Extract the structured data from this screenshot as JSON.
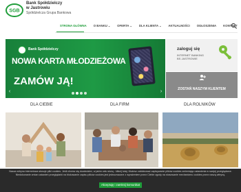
{
  "brand": {
    "logo_text": "SGB",
    "name_line1": "Bank Spółdzielczy",
    "name_line2": "w Jastrowiu",
    "group": "Spółdzielcza Grupa Bankowa",
    "colors": {
      "primary": "#1f9d3a",
      "dark": "#2a2a2a"
    }
  },
  "nav": {
    "items": [
      {
        "label": "STRONA GŁÓWNA",
        "active": true,
        "dropdown": false
      },
      {
        "label": "O BANKU",
        "active": false,
        "dropdown": true
      },
      {
        "label": "OFERTA",
        "active": false,
        "dropdown": true
      },
      {
        "label": "DLA KLIENTA",
        "active": false,
        "dropdown": true
      },
      {
        "label": "AKTUALNOŚCI",
        "active": false,
        "dropdown": false
      },
      {
        "label": "OGŁOSZENIA",
        "active": false,
        "dropdown": false
      },
      {
        "label": "KONTAKT",
        "active": false,
        "dropdown": false
      }
    ],
    "search_icon": "search-icon"
  },
  "slider": {
    "brand": "Bank Spółdzielczy",
    "title": "NOWA KARTA MŁODZIEŻOWA",
    "cta": "ZAMÓW JĄ!",
    "slides": 4,
    "active_slide": 2
  },
  "login": {
    "title": "zaloguj się",
    "line1": "INTERNET BANKING",
    "line2": "BS Jastrowie",
    "icon": "key-icon"
  },
  "open_account": {
    "label": "ZOSTAŃ NASZYM KLIENTEM",
    "icon": "add-user-icon"
  },
  "categories": [
    {
      "label": "DLA CIEBIE"
    },
    {
      "label": "DLA FIRM"
    },
    {
      "label": "DLA ROLNIKÓW"
    }
  ],
  "cookie": {
    "text": "Nasza witryna internetowa stosuje pliki cookies. Jeśli chcesz się dowiedzieć, w jakim celu służą - kliknij tutaj. Możesz zablokować zapisywanie plików cookies zmieniając ustawienia w swojej przeglądarce. Niedokonanie zmian ustawień przeglądarki na blokowanie zapisu plików cookies jest jednoznaczne z wyrażeniem przez Ciebie zgody na stosowanie mechanizmu cookies przez naszą witrynę.",
    "accept_label": "Akceptuję i zamknij komunikat"
  }
}
